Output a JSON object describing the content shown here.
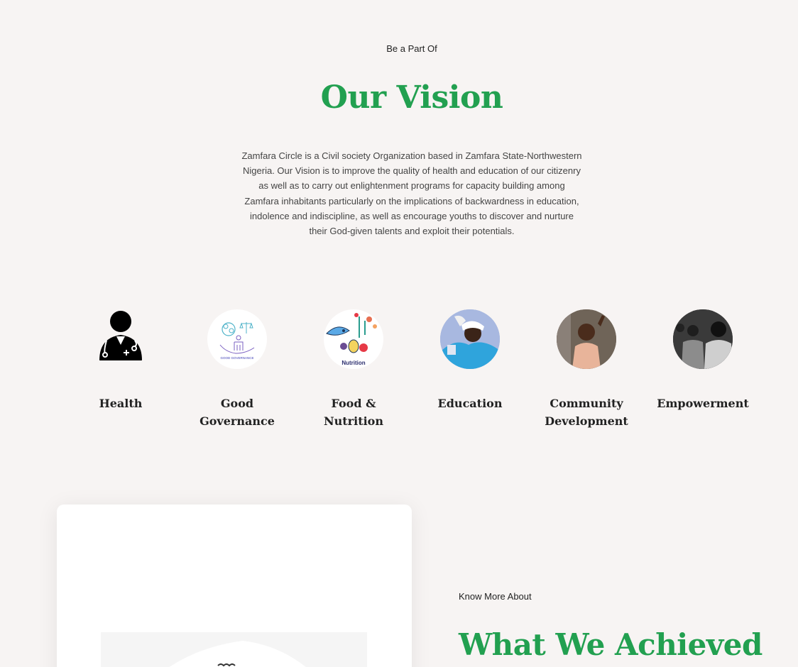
{
  "vision": {
    "eyebrow": "Be a Part Of",
    "title": "Our Vision",
    "text": "Zamfara Circle is a Civil society Organization based in Zamfara State-Northwestern Nigeria. Our Vision is to improve the quality of health and education of our citizenry as well as to carry out enlightenment programs for capacity building among Zamfara inhabitants particularly on the implications of backwardness in education, indolence and indiscipline, as well as encourage youths to discover and nurture their God-given talents and exploit their potentials."
  },
  "pillars": [
    {
      "label": "Health",
      "icon": "doctor-icon"
    },
    {
      "label": "Good Governance",
      "icon": "good-governance-icon",
      "caption": "GOOD GOVERNANCE"
    },
    {
      "label": "Food & Nutrition",
      "icon": "nutrition-icon",
      "caption": "Nutrition"
    },
    {
      "label": "Education",
      "icon": "education-photo"
    },
    {
      "label": "Community Development",
      "icon": "community-photo"
    },
    {
      "label": "Empowerment",
      "icon": "empowerment-photo"
    }
  ],
  "about": {
    "eyebrow": "Know More About",
    "title": "What We Achieved"
  },
  "colors": {
    "accent_green": "#22a050",
    "background": "#f7f4f3"
  }
}
